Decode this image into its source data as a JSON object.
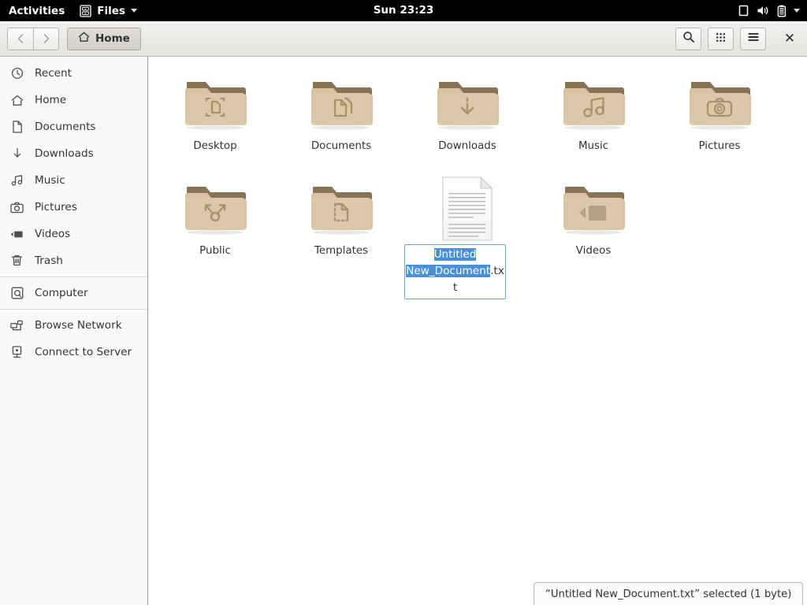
{
  "top_bar": {
    "activities_label": "Activities",
    "app_name": "Files",
    "app_icon": "files-cabinet-icon",
    "clock": "Sun 23:23",
    "status_icons": [
      "display-icon",
      "volume-icon",
      "battery-icon",
      "chevron-down-icon"
    ]
  },
  "header": {
    "back_label": "",
    "forward_label": "",
    "path_label": "Home",
    "path_icon": "home-icon",
    "search_icon": "search-icon",
    "grid_view_icon": "grid-view-icon",
    "menu_icon": "hamburger-menu-icon",
    "close_label": "✕"
  },
  "sidebar": {
    "items": [
      {
        "label": "Recent",
        "icon": "clock-icon"
      },
      {
        "label": "Home",
        "icon": "home-icon"
      },
      {
        "label": "Documents",
        "icon": "document-icon"
      },
      {
        "label": "Downloads",
        "icon": "download-arrow-icon"
      },
      {
        "label": "Music",
        "icon": "music-note-icon"
      },
      {
        "label": "Pictures",
        "icon": "camera-icon"
      },
      {
        "label": "Videos",
        "icon": "video-camera-icon"
      },
      {
        "label": "Trash",
        "icon": "trash-icon"
      },
      {
        "label": "Computer",
        "icon": "hard-drive-icon"
      },
      {
        "label": "Browse Network",
        "icon": "network-icon"
      },
      {
        "label": "Connect to Server",
        "icon": "server-icon"
      }
    ]
  },
  "main": {
    "items": [
      {
        "label": "Desktop",
        "kind": "folder",
        "emblem": "desktop-emblem"
      },
      {
        "label": "Documents",
        "kind": "folder",
        "emblem": "documents-emblem"
      },
      {
        "label": "Downloads",
        "kind": "folder",
        "emblem": "downloads-emblem"
      },
      {
        "label": "Music",
        "kind": "folder",
        "emblem": "music-emblem"
      },
      {
        "label": "Pictures",
        "kind": "folder",
        "emblem": "pictures-emblem"
      },
      {
        "label": "Public",
        "kind": "folder",
        "emblem": "public-emblem"
      },
      {
        "label": "Templates",
        "kind": "folder",
        "emblem": "templates-emblem"
      },
      {
        "label": "Untitled New_Document.txt",
        "kind": "textfile",
        "emblem": "text-file-icon"
      },
      {
        "label": "Videos",
        "kind": "folder",
        "emblem": "videos-emblem"
      }
    ],
    "rename": {
      "active": true,
      "full_value": "Untitled New_Document.txt",
      "selected_text": "Untitled New_Document",
      "unselected_text": ".txt",
      "line1_selected": "Untitled",
      "line2_selected": "New_Document",
      "line2_plain": ".tx",
      "line3_plain": "t"
    }
  },
  "status": {
    "text": "“Untitled New_Document.txt” selected  (1 byte)"
  },
  "colors": {
    "selection_blue": "#4a90d9",
    "folder_body": "#d9c6a5",
    "folder_tab": "#8e7b5d",
    "topbar_bg": "#000000",
    "sidebar_bg": "#f9f9f8",
    "header_bg": "#ebe9e6"
  }
}
